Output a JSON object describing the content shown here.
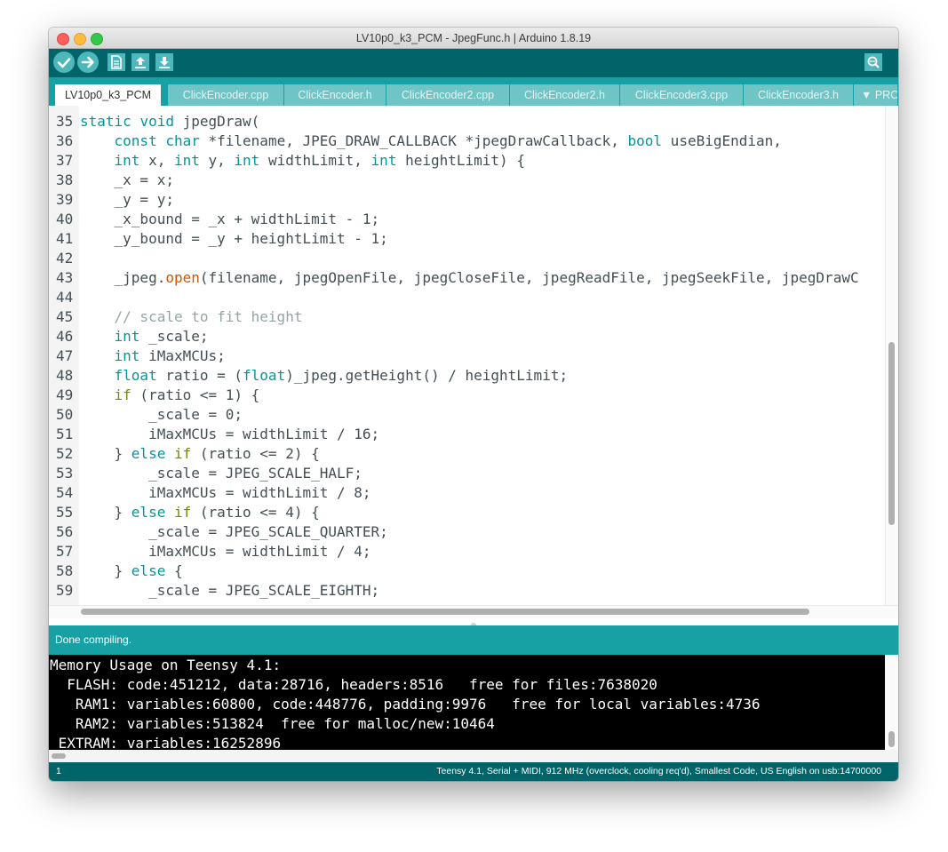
{
  "window": {
    "title": "LV10p0_k3_PCM - JpegFunc.h | Arduino 1.8.19"
  },
  "toolbar": {
    "verify": "verify-icon",
    "upload": "upload-arrow-icon",
    "new": "new-file-icon",
    "open": "open-arrow-up-icon",
    "save": "save-arrow-down-icon",
    "serial_monitor": "serial-monitor-icon",
    "colors": {
      "toolbar_bg": "#006468",
      "button": "#4db7bb",
      "tab_bar": "#17a1a5"
    }
  },
  "tabs": [
    {
      "label": "LV10p0_k3_PCM"
    },
    {
      "label": "ClickEncoder.cpp"
    },
    {
      "label": "ClickEncoder.h"
    },
    {
      "label": "ClickEncoder2.cpp"
    },
    {
      "label": "ClickEncoder2.h"
    },
    {
      "label": "ClickEncoder3.cpp"
    },
    {
      "label": "ClickEncoder3.h"
    },
    {
      "label": "▼ PRO"
    }
  ],
  "editor": {
    "lines": [
      {
        "n": "35",
        "code": "static void jpegDraw("
      },
      {
        "n": "36",
        "code": "    const char *filename, JPEG_DRAW_CALLBACK *jpegDrawCallback, bool useBigEndian,"
      },
      {
        "n": "37",
        "code": "    int x, int y, int widthLimit, int heightLimit) {"
      },
      {
        "n": "38",
        "code": "    _x = x;"
      },
      {
        "n": "39",
        "code": "    _y = y;"
      },
      {
        "n": "40",
        "code": "    _x_bound = _x + widthLimit - 1;"
      },
      {
        "n": "41",
        "code": "    _y_bound = _y + heightLimit - 1;"
      },
      {
        "n": "42",
        "code": ""
      },
      {
        "n": "43",
        "code": "    _jpeg.open(filename, jpegOpenFile, jpegCloseFile, jpegReadFile, jpegSeekFile, jpegDrawC"
      },
      {
        "n": "44",
        "code": ""
      },
      {
        "n": "45",
        "code": "    // scale to fit height"
      },
      {
        "n": "46",
        "code": "    int _scale;"
      },
      {
        "n": "47",
        "code": "    int iMaxMCUs;"
      },
      {
        "n": "48",
        "code": "    float ratio = (float)_jpeg.getHeight() / heightLimit;"
      },
      {
        "n": "49",
        "code": "    if (ratio <= 1) {"
      },
      {
        "n": "50",
        "code": "        _scale = 0;"
      },
      {
        "n": "51",
        "code": "        iMaxMCUs = widthLimit / 16;"
      },
      {
        "n": "52",
        "code": "    } else if (ratio <= 2) {"
      },
      {
        "n": "53",
        "code": "        _scale = JPEG_SCALE_HALF;"
      },
      {
        "n": "54",
        "code": "        iMaxMCUs = widthLimit / 8;"
      },
      {
        "n": "55",
        "code": "    } else if (ratio <= 4) {"
      },
      {
        "n": "56",
        "code": "        _scale = JPEG_SCALE_QUARTER;"
      },
      {
        "n": "57",
        "code": "        iMaxMCUs = widthLimit / 4;"
      },
      {
        "n": "58",
        "code": "    } else {"
      },
      {
        "n": "59",
        "code": "        _scale = JPEG_SCALE_EIGHTH;"
      }
    ]
  },
  "status": {
    "message": "Done compiling."
  },
  "console": {
    "lines": [
      "Memory Usage on Teensy 4.1:",
      "  FLASH: code:451212, data:28716, headers:8516   free for files:7638020",
      "   RAM1: variables:60800, code:448776, padding:9976   free for local variables:4736",
      "   RAM2: variables:513824  free for malloc/new:10464",
      " EXTRAM: variables:16252896"
    ]
  },
  "footer": {
    "line_number": "1",
    "board_info": "Teensy 4.1, Serial + MIDI, 912 MHz (overclock, cooling req'd), Smallest Code, US English on usb:14700000"
  }
}
